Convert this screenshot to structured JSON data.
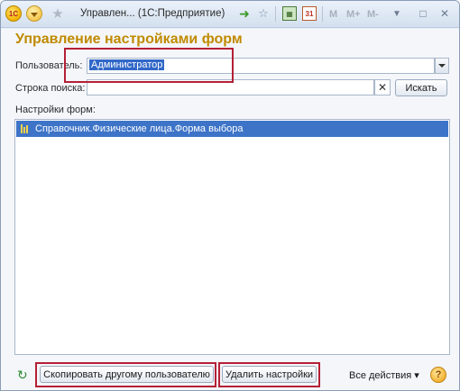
{
  "titlebar": {
    "logo_text": "1С",
    "title": "Управлен... (1С:Предприятие)",
    "calendar_text": "31",
    "m_label": "M",
    "m_plus_label": "M+",
    "m_minus_label": "M-",
    "window_controls": {
      "restore": "□",
      "close": "✕"
    },
    "icons": [
      "logo-1c-icon",
      "main-menu-icon",
      "favorite-star-icon",
      "forward-arrow-icon",
      "add-favorite-icon",
      "calculator-icon",
      "calendar-icon",
      "dropdown-arrow-icon"
    ]
  },
  "form": {
    "title": "Управление настройками форм",
    "user_label": "Пользователь:",
    "user_value": "Администратор",
    "search_label": "Строка поиска:",
    "search_value": "",
    "clear_symbol": "✕",
    "search_button": "Искать",
    "settings_label": "Настройки форм:",
    "settings_items": [
      {
        "label": "Справочник.Физические лица.Форма выбора",
        "selected": true
      }
    ]
  },
  "footer": {
    "refresh_symbol": "↻",
    "copy_button": "Скопировать другому пользователю",
    "delete_button": "Удалить настройки",
    "all_actions": "Все действия ▾",
    "help_symbol": "?"
  },
  "colors": {
    "title": "#c08a00",
    "selection": "#3d74c8",
    "highlight_box": "#b42035"
  }
}
